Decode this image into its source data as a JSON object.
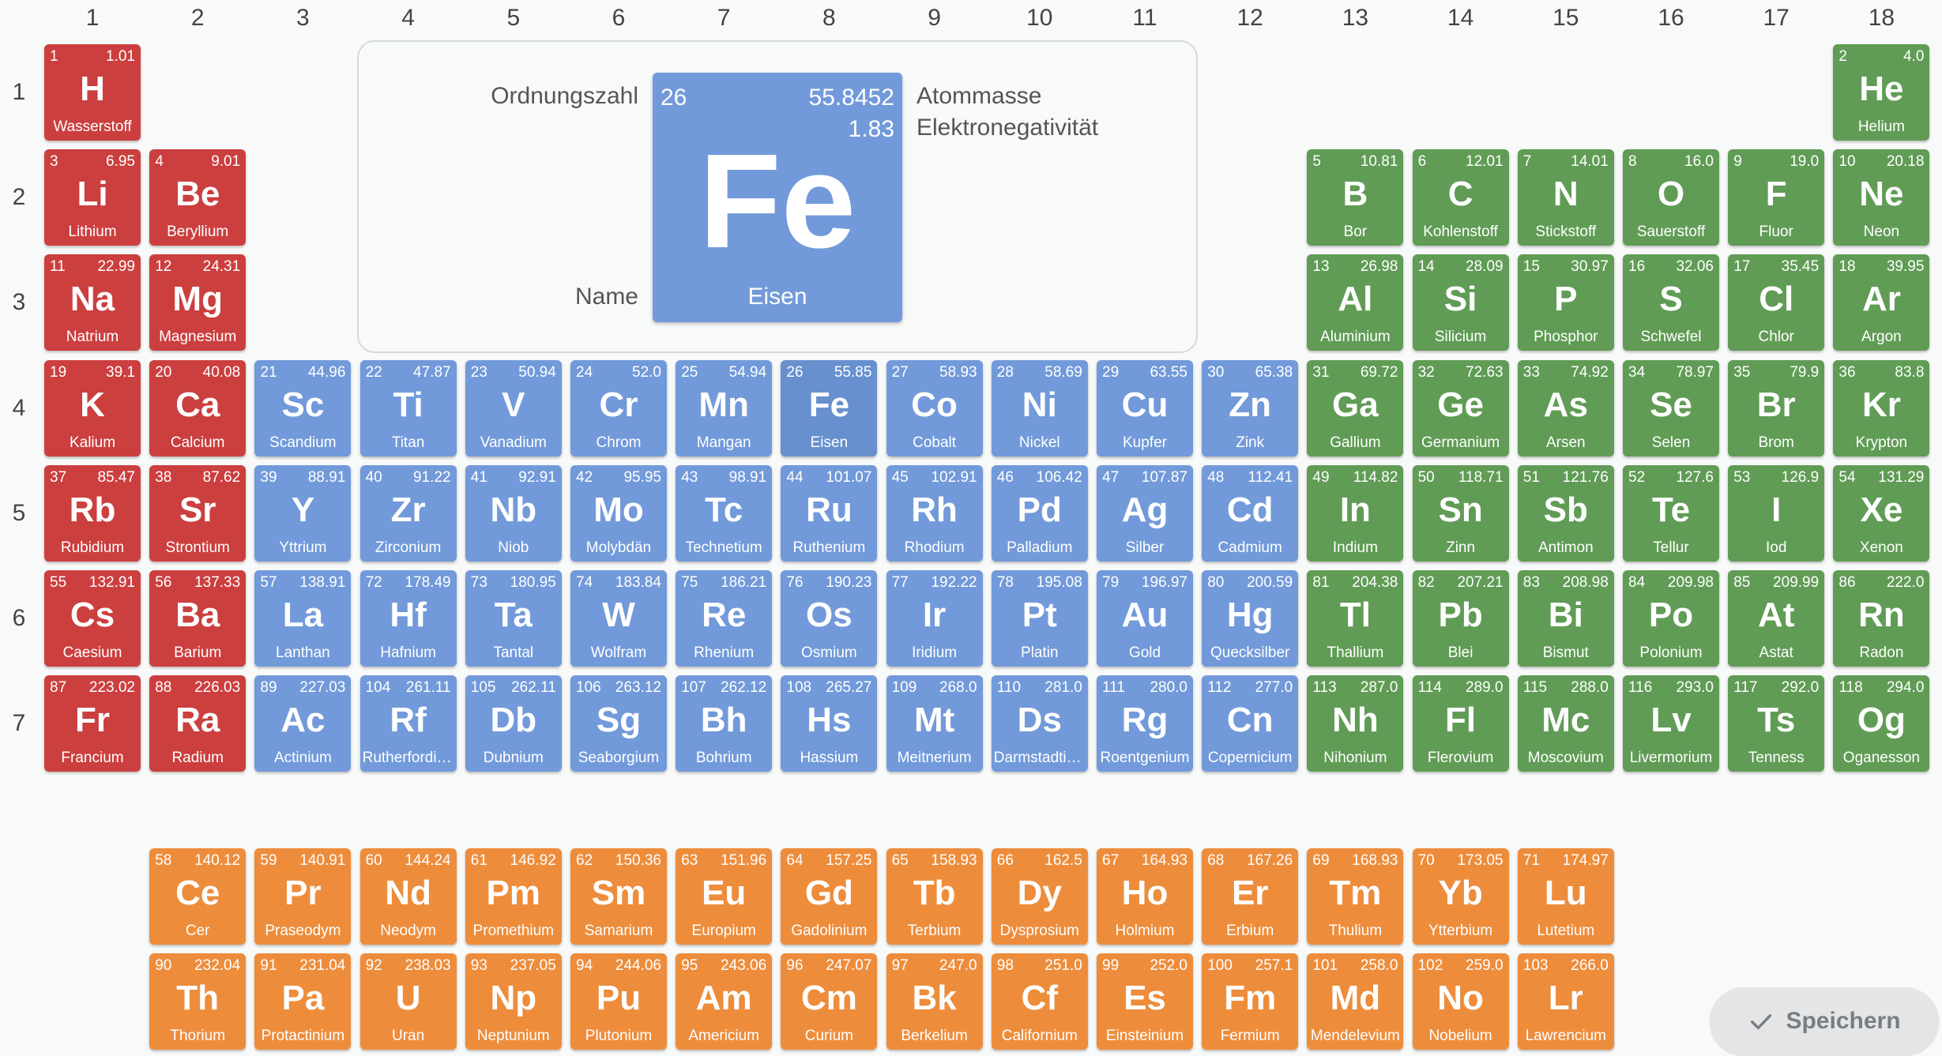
{
  "column_numbers": [
    "1",
    "2",
    "3",
    "4",
    "5",
    "6",
    "7",
    "8",
    "9",
    "10",
    "11",
    "12",
    "13",
    "14",
    "15",
    "16",
    "17",
    "18"
  ],
  "row_numbers": [
    "1",
    "2",
    "3",
    "4",
    "5",
    "6",
    "7"
  ],
  "legend": {
    "labels": {
      "atomic_number": "Ordnungszahl",
      "atomic_mass": "Atommasse",
      "electronegativity": "Elektronegativität",
      "name": "Name"
    },
    "example": {
      "number": "26",
      "mass": "55.8452",
      "electronegativity": "1.83",
      "symbol": "Fe",
      "name": "Eisen"
    }
  },
  "save_button": {
    "label": "Speichern",
    "icon": "check-icon"
  },
  "colors": {
    "alkali": "#cc3f3f",
    "transition": "#729ada",
    "nonmetal": "#609c55",
    "lanthanide": "#ed8d3c"
  },
  "selected_symbol": "Fe",
  "elements": [
    [
      "1",
      "1.01",
      "H",
      "Wasserstoff",
      1,
      1,
      "alkali"
    ],
    [
      "2",
      "4.0",
      "He",
      "Helium",
      18,
      1,
      "nonmetal"
    ],
    [
      "3",
      "6.95",
      "Li",
      "Lithium",
      1,
      2,
      "alkali"
    ],
    [
      "4",
      "9.01",
      "Be",
      "Beryllium",
      2,
      2,
      "alkali"
    ],
    [
      "5",
      "10.81",
      "B",
      "Bor",
      13,
      2,
      "nonmetal"
    ],
    [
      "6",
      "12.01",
      "C",
      "Kohlenstoff",
      14,
      2,
      "nonmetal"
    ],
    [
      "7",
      "14.01",
      "N",
      "Stickstoff",
      15,
      2,
      "nonmetal"
    ],
    [
      "8",
      "16.0",
      "O",
      "Sauerstoff",
      16,
      2,
      "nonmetal"
    ],
    [
      "9",
      "19.0",
      "F",
      "Fluor",
      17,
      2,
      "nonmetal"
    ],
    [
      "10",
      "20.18",
      "Ne",
      "Neon",
      18,
      2,
      "nonmetal"
    ],
    [
      "11",
      "22.99",
      "Na",
      "Natrium",
      1,
      3,
      "alkali"
    ],
    [
      "12",
      "24.31",
      "Mg",
      "Magnesium",
      2,
      3,
      "alkali"
    ],
    [
      "13",
      "26.98",
      "Al",
      "Aluminium",
      13,
      3,
      "nonmetal"
    ],
    [
      "14",
      "28.09",
      "Si",
      "Silicium",
      14,
      3,
      "nonmetal"
    ],
    [
      "15",
      "30.97",
      "P",
      "Phosphor",
      15,
      3,
      "nonmetal"
    ],
    [
      "16",
      "32.06",
      "S",
      "Schwefel",
      16,
      3,
      "nonmetal"
    ],
    [
      "17",
      "35.45",
      "Cl",
      "Chlor",
      17,
      3,
      "nonmetal"
    ],
    [
      "18",
      "39.95",
      "Ar",
      "Argon",
      18,
      3,
      "nonmetal"
    ],
    [
      "19",
      "39.1",
      "K",
      "Kalium",
      1,
      4,
      "alkali"
    ],
    [
      "20",
      "40.08",
      "Ca",
      "Calcium",
      2,
      4,
      "alkali"
    ],
    [
      "21",
      "44.96",
      "Sc",
      "Scandium",
      3,
      4,
      "transition"
    ],
    [
      "22",
      "47.87",
      "Ti",
      "Titan",
      4,
      4,
      "transition"
    ],
    [
      "23",
      "50.94",
      "V",
      "Vanadium",
      5,
      4,
      "transition"
    ],
    [
      "24",
      "52.0",
      "Cr",
      "Chrom",
      6,
      4,
      "transition"
    ],
    [
      "25",
      "54.94",
      "Mn",
      "Mangan",
      7,
      4,
      "transition"
    ],
    [
      "26",
      "55.85",
      "Fe",
      "Eisen",
      8,
      4,
      "transition"
    ],
    [
      "27",
      "58.93",
      "Co",
      "Cobalt",
      9,
      4,
      "transition"
    ],
    [
      "28",
      "58.69",
      "Ni",
      "Nickel",
      10,
      4,
      "transition"
    ],
    [
      "29",
      "63.55",
      "Cu",
      "Kupfer",
      11,
      4,
      "transition"
    ],
    [
      "30",
      "65.38",
      "Zn",
      "Zink",
      12,
      4,
      "transition"
    ],
    [
      "31",
      "69.72",
      "Ga",
      "Gallium",
      13,
      4,
      "nonmetal"
    ],
    [
      "32",
      "72.63",
      "Ge",
      "Germanium",
      14,
      4,
      "nonmetal"
    ],
    [
      "33",
      "74.92",
      "As",
      "Arsen",
      15,
      4,
      "nonmetal"
    ],
    [
      "34",
      "78.97",
      "Se",
      "Selen",
      16,
      4,
      "nonmetal"
    ],
    [
      "35",
      "79.9",
      "Br",
      "Brom",
      17,
      4,
      "nonmetal"
    ],
    [
      "36",
      "83.8",
      "Kr",
      "Krypton",
      18,
      4,
      "nonmetal"
    ],
    [
      "37",
      "85.47",
      "Rb",
      "Rubidium",
      1,
      5,
      "alkali"
    ],
    [
      "38",
      "87.62",
      "Sr",
      "Strontium",
      2,
      5,
      "alkali"
    ],
    [
      "39",
      "88.91",
      "Y",
      "Yttrium",
      3,
      5,
      "transition"
    ],
    [
      "40",
      "91.22",
      "Zr",
      "Zirconium",
      4,
      5,
      "transition"
    ],
    [
      "41",
      "92.91",
      "Nb",
      "Niob",
      5,
      5,
      "transition"
    ],
    [
      "42",
      "95.95",
      "Mo",
      "Molybdän",
      6,
      5,
      "transition"
    ],
    [
      "43",
      "98.91",
      "Tc",
      "Technetium",
      7,
      5,
      "transition"
    ],
    [
      "44",
      "101.07",
      "Ru",
      "Ruthenium",
      8,
      5,
      "transition"
    ],
    [
      "45",
      "102.91",
      "Rh",
      "Rhodium",
      9,
      5,
      "transition"
    ],
    [
      "46",
      "106.42",
      "Pd",
      "Palladium",
      10,
      5,
      "transition"
    ],
    [
      "47",
      "107.87",
      "Ag",
      "Silber",
      11,
      5,
      "transition"
    ],
    [
      "48",
      "112.41",
      "Cd",
      "Cadmium",
      12,
      5,
      "transition"
    ],
    [
      "49",
      "114.82",
      "In",
      "Indium",
      13,
      5,
      "nonmetal"
    ],
    [
      "50",
      "118.71",
      "Sn",
      "Zinn",
      14,
      5,
      "nonmetal"
    ],
    [
      "51",
      "121.76",
      "Sb",
      "Antimon",
      15,
      5,
      "nonmetal"
    ],
    [
      "52",
      "127.6",
      "Te",
      "Tellur",
      16,
      5,
      "nonmetal"
    ],
    [
      "53",
      "126.9",
      "I",
      "Iod",
      17,
      5,
      "nonmetal"
    ],
    [
      "54",
      "131.29",
      "Xe",
      "Xenon",
      18,
      5,
      "nonmetal"
    ],
    [
      "55",
      "132.91",
      "Cs",
      "Caesium",
      1,
      6,
      "alkali"
    ],
    [
      "56",
      "137.33",
      "Ba",
      "Barium",
      2,
      6,
      "alkali"
    ],
    [
      "57",
      "138.91",
      "La",
      "Lanthan",
      3,
      6,
      "transition"
    ],
    [
      "72",
      "178.49",
      "Hf",
      "Hafnium",
      4,
      6,
      "transition"
    ],
    [
      "73",
      "180.95",
      "Ta",
      "Tantal",
      5,
      6,
      "transition"
    ],
    [
      "74",
      "183.84",
      "W",
      "Wolfram",
      6,
      6,
      "transition"
    ],
    [
      "75",
      "186.21",
      "Re",
      "Rhenium",
      7,
      6,
      "transition"
    ],
    [
      "76",
      "190.23",
      "Os",
      "Osmium",
      8,
      6,
      "transition"
    ],
    [
      "77",
      "192.22",
      "Ir",
      "Iridium",
      9,
      6,
      "transition"
    ],
    [
      "78",
      "195.08",
      "Pt",
      "Platin",
      10,
      6,
      "transition"
    ],
    [
      "79",
      "196.97",
      "Au",
      "Gold",
      11,
      6,
      "transition"
    ],
    [
      "80",
      "200.59",
      "Hg",
      "Quecksilber",
      12,
      6,
      "transition"
    ],
    [
      "81",
      "204.38",
      "Tl",
      "Thallium",
      13,
      6,
      "nonmetal"
    ],
    [
      "82",
      "207.21",
      "Pb",
      "Blei",
      14,
      6,
      "nonmetal"
    ],
    [
      "83",
      "208.98",
      "Bi",
      "Bismut",
      15,
      6,
      "nonmetal"
    ],
    [
      "84",
      "209.98",
      "Po",
      "Polonium",
      16,
      6,
      "nonmetal"
    ],
    [
      "85",
      "209.99",
      "At",
      "Astat",
      17,
      6,
      "nonmetal"
    ],
    [
      "86",
      "222.0",
      "Rn",
      "Radon",
      18,
      6,
      "nonmetal"
    ],
    [
      "87",
      "223.02",
      "Fr",
      "Francium",
      1,
      7,
      "alkali"
    ],
    [
      "88",
      "226.03",
      "Ra",
      "Radium",
      2,
      7,
      "alkali"
    ],
    [
      "89",
      "227.03",
      "Ac",
      "Actinium",
      3,
      7,
      "transition"
    ],
    [
      "104",
      "261.11",
      "Rf",
      "Rutherfordium",
      4,
      7,
      "transition"
    ],
    [
      "105",
      "262.11",
      "Db",
      "Dubnium",
      5,
      7,
      "transition"
    ],
    [
      "106",
      "263.12",
      "Sg",
      "Seaborgium",
      6,
      7,
      "transition"
    ],
    [
      "107",
      "262.12",
      "Bh",
      "Bohrium",
      7,
      7,
      "transition"
    ],
    [
      "108",
      "265.27",
      "Hs",
      "Hassium",
      8,
      7,
      "transition"
    ],
    [
      "109",
      "268.0",
      "Mt",
      "Meitnerium",
      9,
      7,
      "transition"
    ],
    [
      "110",
      "281.0",
      "Ds",
      "Darmstadtium",
      10,
      7,
      "transition"
    ],
    [
      "111",
      "280.0",
      "Rg",
      "Roentgenium",
      11,
      7,
      "transition"
    ],
    [
      "112",
      "277.0",
      "Cn",
      "Copernicium",
      12,
      7,
      "transition"
    ],
    [
      "113",
      "287.0",
      "Nh",
      "Nihonium",
      13,
      7,
      "nonmetal"
    ],
    [
      "114",
      "289.0",
      "Fl",
      "Flerovium",
      14,
      7,
      "nonmetal"
    ],
    [
      "115",
      "288.0",
      "Mc",
      "Moscovium",
      15,
      7,
      "nonmetal"
    ],
    [
      "116",
      "293.0",
      "Lv",
      "Livermorium",
      16,
      7,
      "nonmetal"
    ],
    [
      "117",
      "292.0",
      "Ts",
      "Tenness",
      17,
      7,
      "nonmetal"
    ],
    [
      "118",
      "294.0",
      "Og",
      "Oganesson",
      18,
      7,
      "nonmetal"
    ],
    [
      "58",
      "140.12",
      "Ce",
      "Cer",
      2,
      9,
      "lanthanide"
    ],
    [
      "59",
      "140.91",
      "Pr",
      "Praseodym",
      3,
      9,
      "lanthanide"
    ],
    [
      "60",
      "144.24",
      "Nd",
      "Neodym",
      4,
      9,
      "lanthanide"
    ],
    [
      "61",
      "146.92",
      "Pm",
      "Promethium",
      5,
      9,
      "lanthanide"
    ],
    [
      "62",
      "150.36",
      "Sm",
      "Samarium",
      6,
      9,
      "lanthanide"
    ],
    [
      "63",
      "151.96",
      "Eu",
      "Europium",
      7,
      9,
      "lanthanide"
    ],
    [
      "64",
      "157.25",
      "Gd",
      "Gadolinium",
      8,
      9,
      "lanthanide"
    ],
    [
      "65",
      "158.93",
      "Tb",
      "Terbium",
      9,
      9,
      "lanthanide"
    ],
    [
      "66",
      "162.5",
      "Dy",
      "Dysprosium",
      10,
      9,
      "lanthanide"
    ],
    [
      "67",
      "164.93",
      "Ho",
      "Holmium",
      11,
      9,
      "lanthanide"
    ],
    [
      "68",
      "167.26",
      "Er",
      "Erbium",
      12,
      9,
      "lanthanide"
    ],
    [
      "69",
      "168.93",
      "Tm",
      "Thulium",
      13,
      9,
      "lanthanide"
    ],
    [
      "70",
      "173.05",
      "Yb",
      "Ytterbium",
      14,
      9,
      "lanthanide"
    ],
    [
      "71",
      "174.97",
      "Lu",
      "Lutetium",
      15,
      9,
      "lanthanide"
    ],
    [
      "90",
      "232.04",
      "Th",
      "Thorium",
      2,
      10,
      "lanthanide"
    ],
    [
      "91",
      "231.04",
      "Pa",
      "Protactinium",
      3,
      10,
      "lanthanide"
    ],
    [
      "92",
      "238.03",
      "U",
      "Uran",
      4,
      10,
      "lanthanide"
    ],
    [
      "93",
      "237.05",
      "Np",
      "Neptunium",
      5,
      10,
      "lanthanide"
    ],
    [
      "94",
      "244.06",
      "Pu",
      "Plutonium",
      6,
      10,
      "lanthanide"
    ],
    [
      "95",
      "243.06",
      "Am",
      "Americium",
      7,
      10,
      "lanthanide"
    ],
    [
      "96",
      "247.07",
      "Cm",
      "Curium",
      8,
      10,
      "lanthanide"
    ],
    [
      "97",
      "247.0",
      "Bk",
      "Berkelium",
      9,
      10,
      "lanthanide"
    ],
    [
      "98",
      "251.0",
      "Cf",
      "Californium",
      10,
      10,
      "lanthanide"
    ],
    [
      "99",
      "252.0",
      "Es",
      "Einsteinium",
      11,
      10,
      "lanthanide"
    ],
    [
      "100",
      "257.1",
      "Fm",
      "Fermium",
      12,
      10,
      "lanthanide"
    ],
    [
      "101",
      "258.0",
      "Md",
      "Mendelevium",
      13,
      10,
      "lanthanide"
    ],
    [
      "102",
      "259.0",
      "No",
      "Nobelium",
      14,
      10,
      "lanthanide"
    ],
    [
      "103",
      "266.0",
      "Lr",
      "Lawrencium",
      15,
      10,
      "lanthanide"
    ]
  ]
}
